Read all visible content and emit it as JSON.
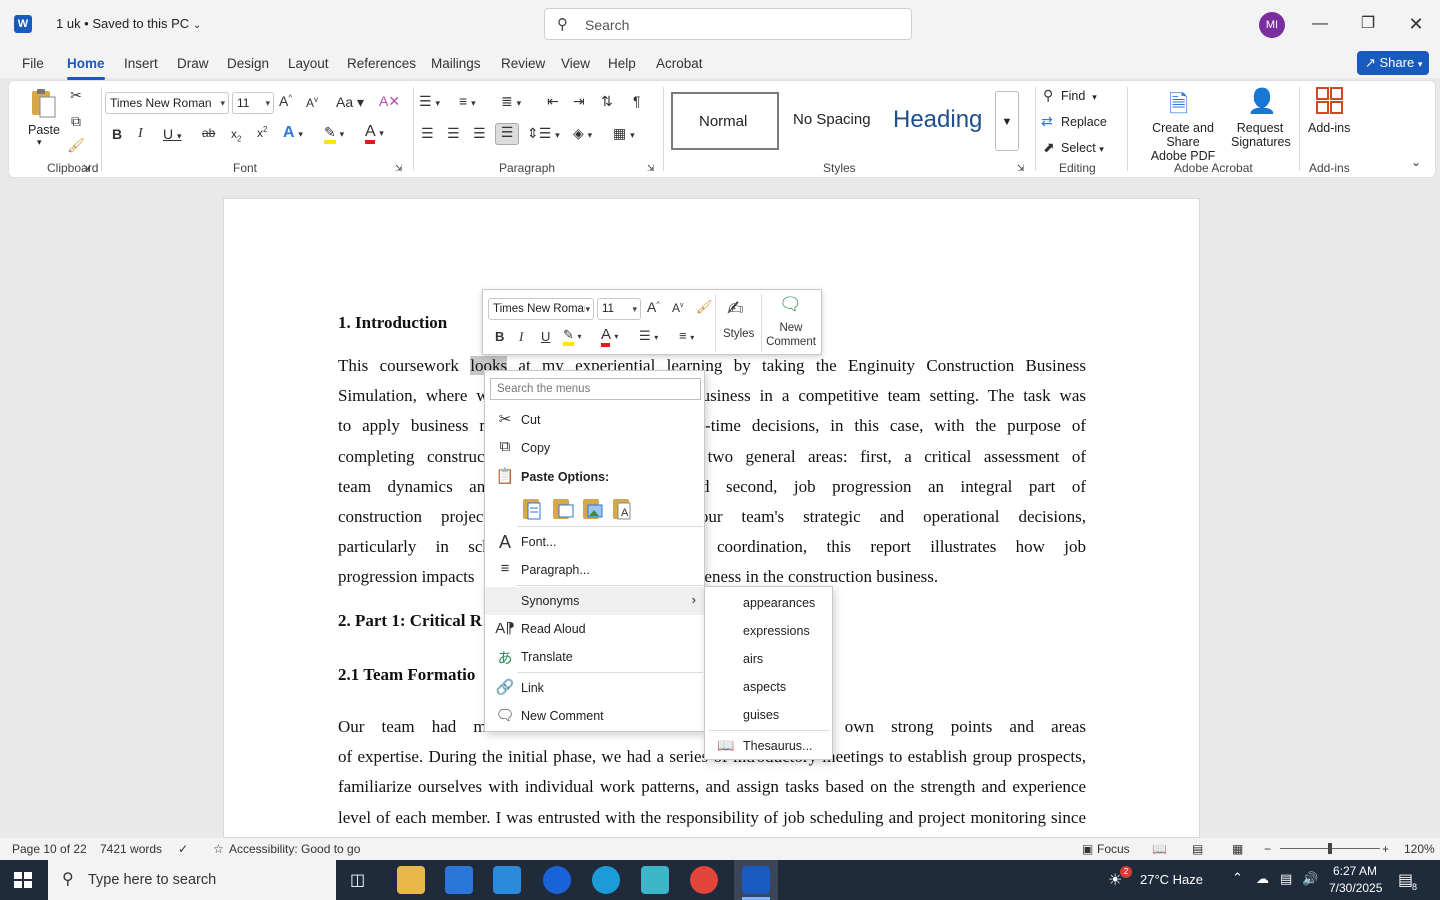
{
  "titlebar": {
    "doc_title": "1 uk • Saved to this PC",
    "search_placeholder": "Search",
    "avatar_initials": "MI"
  },
  "tabs": [
    "File",
    "Home",
    "Insert",
    "Draw",
    "Design",
    "Layout",
    "References",
    "Mailings",
    "Review",
    "View",
    "Help",
    "Acrobat"
  ],
  "active_tab": "Home",
  "share_label": "Share",
  "ribbon": {
    "clipboard": {
      "paste": "Paste",
      "group": "Clipboard"
    },
    "font": {
      "name": "Times New Roman",
      "size": "11",
      "group": "Font"
    },
    "paragraph": {
      "group": "Paragraph"
    },
    "styles": {
      "items": [
        "Normal",
        "No Spacing",
        "Heading"
      ],
      "group": "Styles"
    },
    "editing": {
      "find": "Find",
      "replace": "Replace",
      "select": "Select",
      "group": "Editing"
    },
    "acrobat": {
      "create": "Create and Share",
      "create2": "Adobe PDF",
      "request": "Request",
      "request2": "Signatures",
      "group": "Adobe Acrobat"
    },
    "addins": {
      "label": "Add-ins",
      "group": "Add-ins"
    }
  },
  "document": {
    "h1": "1. Introduction",
    "p1_lines": [
      "This coursework looks at my experiential learning by taking the Enginuity Construction Business",
      "Simulation, where w           n business in a competitive team setting. The task was",
      "to apply business m           real-time decisions, in this case, with the purpose of",
      "completing construc          resses two general areas: first, a critical assessment of",
      "team dynamics and          ; and second, job progression an integral part of",
      "construction project         s of our team's strategic and operational decisions,",
      "particularly in sche         mental coordination, this report illustrates how job",
      "progression impacts          competitiveness in the construction business."
    ],
    "h2": "2. Part 1: Critical R",
    "h3": "2.1 Team Formatio",
    "p2_lines": [
      "Our team had memb               h their own strong points and areas",
      "of expertise. During the initial phase, we had a series of introductory meetings to establish group prospects,",
      "familiarize ourselves with individual work patterns, and assign tasks based on the strength and experience",
      "level of each member. I was entrusted with the responsibility of job scheduling and project monitoring since"
    ]
  },
  "mini_toolbar": {
    "font": "Times New Roman",
    "size": "11",
    "styles": "Styles",
    "new_comment": "New",
    "new_comment2": "Comment"
  },
  "context_menu": {
    "search_placeholder": "Search the menus",
    "cut": "Cut",
    "copy": "Copy",
    "paste_options": "Paste Options:",
    "font": "Font...",
    "paragraph": "Paragraph...",
    "synonyms": "Synonyms",
    "read_aloud": "Read Aloud",
    "translate": "Translate",
    "link": "Link",
    "new_comment": "New Comment"
  },
  "synonyms": [
    "appearances",
    "expressions",
    "airs",
    "aspects",
    "guises"
  ],
  "thesaurus": "Thesaurus...",
  "status": {
    "page": "Page 10 of 22",
    "words": "7421 words",
    "accessibility": "Accessibility: Good to go",
    "focus": "Focus",
    "zoom": "120%"
  },
  "taskbar": {
    "search": "Type here to search",
    "weather": "27°C  Haze",
    "time": "6:27 AM",
    "date": "7/30/2025",
    "badge": "2",
    "notif": "8"
  },
  "colors": {
    "accent": "#185abd",
    "highlight": "#ffe600",
    "font_red": "#e01b1b"
  }
}
